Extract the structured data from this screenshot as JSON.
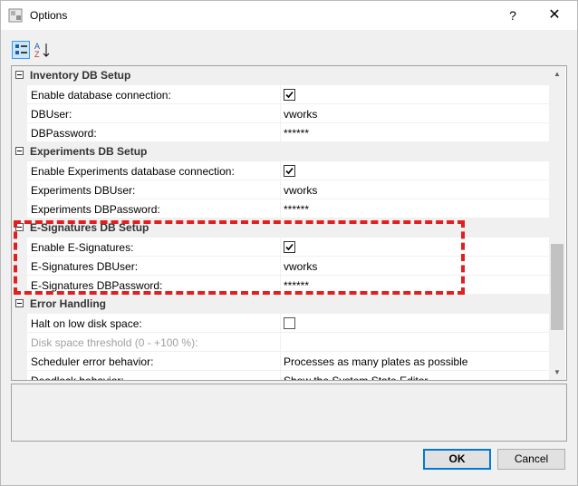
{
  "window": {
    "title": "Options",
    "help_label": "?",
    "close_label": "✕"
  },
  "toolbar": {
    "categorized_icon": "categorized-view-icon",
    "alphabetical_icon": "alphabetical-sort-icon",
    "alphabetical_glyph_a": "A",
    "alphabetical_glyph_z": "Z"
  },
  "grid": {
    "rows": [
      {
        "type": "category",
        "label": "Inventory DB Setup"
      },
      {
        "type": "prop",
        "name": "Enable database connection:",
        "value": "",
        "checkbox": true
      },
      {
        "type": "prop",
        "name": "DBUser:",
        "value": "vworks"
      },
      {
        "type": "prop",
        "name": "DBPassword:",
        "value": "******"
      },
      {
        "type": "category",
        "label": "Experiments DB Setup"
      },
      {
        "type": "prop",
        "name": "Enable Experiments database connection:",
        "value": "",
        "checkbox": true
      },
      {
        "type": "prop",
        "name": "Experiments DBUser:",
        "value": "vworks"
      },
      {
        "type": "prop",
        "name": "Experiments DBPassword:",
        "value": "******"
      },
      {
        "type": "category",
        "label": "E-Signatures DB Setup"
      },
      {
        "type": "prop",
        "name": "Enable E-Signatures:",
        "value": "",
        "checkbox": true
      },
      {
        "type": "prop",
        "name": "E-Signatures DBUser:",
        "value": "vworks"
      },
      {
        "type": "prop",
        "name": "E-Signatures DBPassword:",
        "value": "******"
      },
      {
        "type": "category",
        "label": "Error Handling"
      },
      {
        "type": "prop",
        "name": "Halt on low disk space:",
        "value": "",
        "checkbox": false
      },
      {
        "type": "prop",
        "name": "Disk space threshold (0 - +100 %):",
        "value": "",
        "disabled": true
      },
      {
        "type": "prop",
        "name": "Scheduler error behavior:",
        "value": "Processes as many plates as possible"
      },
      {
        "type": "prop",
        "name": "Deadlock behavior:",
        "value": "Show the System State Editor"
      }
    ]
  },
  "buttons": {
    "ok": "OK",
    "cancel": "Cancel"
  },
  "colors": {
    "highlight": "#e02020",
    "focus": "#0078d7"
  }
}
